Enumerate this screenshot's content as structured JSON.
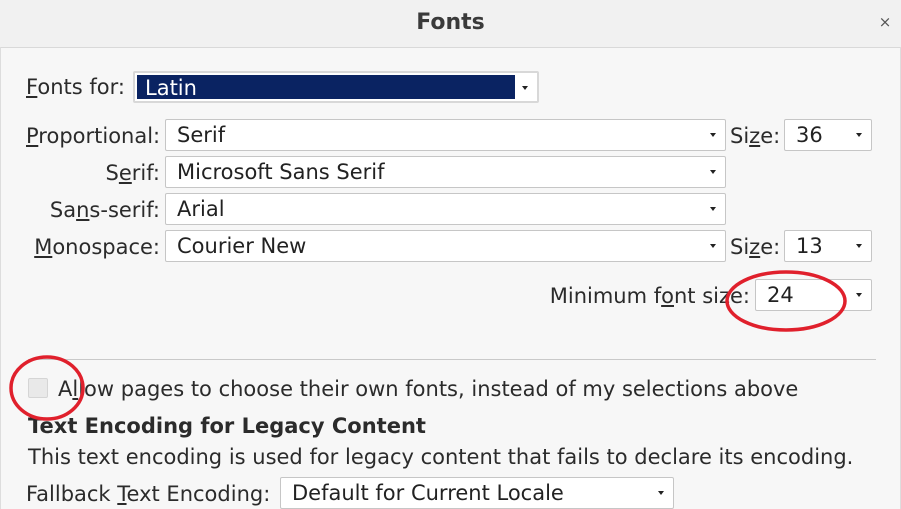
{
  "window": {
    "title": "Fonts",
    "close_glyph": "×"
  },
  "fonts_for": {
    "label_u": "F",
    "label_rest": "onts for:",
    "value": "Latin"
  },
  "proportional": {
    "label_u": "P",
    "label_rest": "roportional:",
    "value": "Serif"
  },
  "proportional_size": {
    "label_pre": "Si",
    "label_u": "z",
    "label_post": "e:",
    "value": "36"
  },
  "serif": {
    "label_pre": "S",
    "label_u": "e",
    "label_post": "rif:",
    "value": "Microsoft Sans Serif"
  },
  "sans_serif": {
    "label_pre": "Sa",
    "label_u": "n",
    "label_post": "s-serif:",
    "value": "Arial"
  },
  "monospace": {
    "label_u": "M",
    "label_rest": "onospace:",
    "value": "Courier New"
  },
  "monospace_size": {
    "label_pre": "Si",
    "label_u": "z",
    "label_post": "e:",
    "value": "13"
  },
  "minimum_font_size": {
    "label_pre": "Minimum f",
    "label_u": "o",
    "label_post": "nt size:",
    "value": "24"
  },
  "allow_pages": {
    "label_pre": "A",
    "label_u": "l",
    "label_post": "low pages to choose their own fonts, instead of my selections above",
    "checked": false
  },
  "encoding": {
    "heading": "Text Encoding for Legacy Content",
    "description": "This text encoding is used for legacy content that fails to declare its encoding.",
    "fallback_label_pre": "Fallback ",
    "fallback_label_u": "T",
    "fallback_label_post": "ext Encoding:",
    "fallback_value": "Default for Current Locale"
  },
  "annotation_color": "#e0202c"
}
